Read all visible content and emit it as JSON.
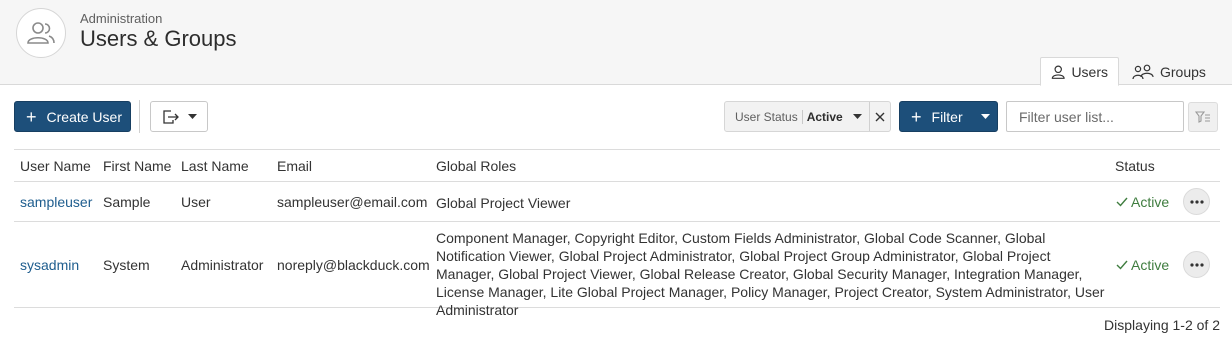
{
  "header": {
    "breadcrumb": "Administration",
    "title": "Users & Groups",
    "avatar_icon": "users-icon"
  },
  "tabs": [
    {
      "label": "Users",
      "icon": "user-icon",
      "active": true
    },
    {
      "label": "Groups",
      "icon": "group-icon",
      "active": false
    }
  ],
  "toolbar": {
    "create_label": "Create User",
    "export_icon": "export-icon",
    "status_filter_label": "User Status",
    "status_filter_value": "Active",
    "filter_label": "Filter",
    "search_placeholder": "Filter user list...",
    "primary_color": "#1d4f7a"
  },
  "table": {
    "columns": [
      "User Name",
      "First Name",
      "Last Name",
      "Email",
      "Global Roles",
      "Status"
    ],
    "rows": [
      {
        "user_name": "sampleuser",
        "first_name": "Sample",
        "last_name": "User",
        "email": "sampleuser@email.com",
        "roles": "Global Project Viewer",
        "status": "Active"
      },
      {
        "user_name": "sysadmin",
        "first_name": "System",
        "last_name": "Administrator",
        "email": "noreply@blackduck.com",
        "roles": "Component Manager, Copyright Editor, Custom Fields Administrator, Global Code Scanner, Global Notification Viewer, Global Project Administrator, Global Project Group Administrator, Global Project Manager, Global Project Viewer, Global Release Creator, Global Security Manager, Integration Manager, License Manager, Lite Global Project Manager, Policy Manager, Project Creator, System Administrator, User Administrator",
        "status": "Active"
      }
    ]
  },
  "pagination": {
    "summary": "Displaying 1-2 of 2"
  }
}
